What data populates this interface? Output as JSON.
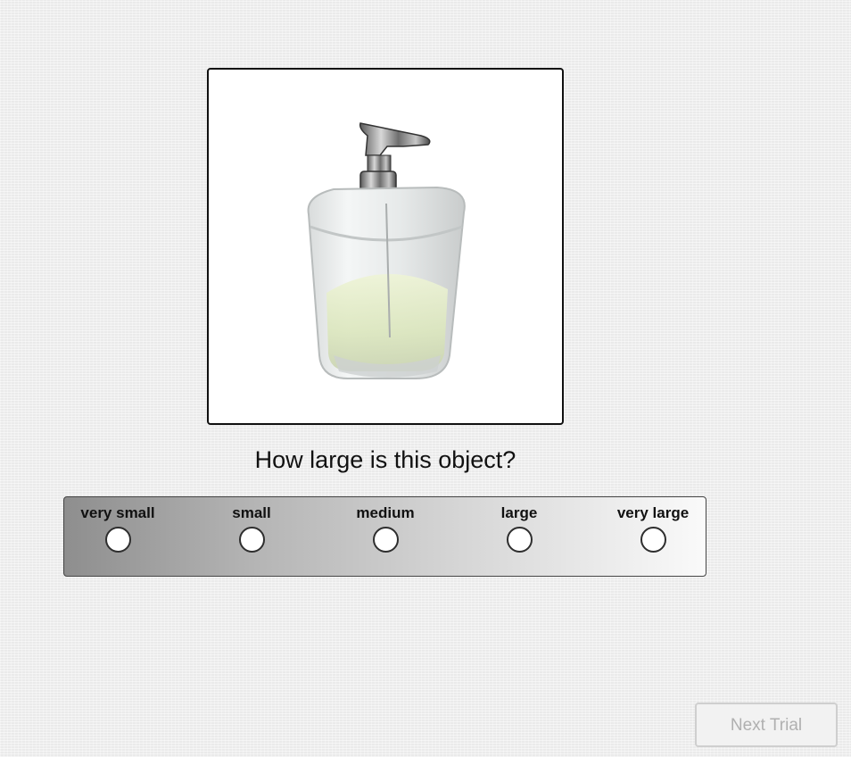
{
  "stimulus": {
    "description_icon": "soap-dispenser-photo"
  },
  "question": "How large is this object?",
  "scale": {
    "options": [
      {
        "label": "very small"
      },
      {
        "label": "small"
      },
      {
        "label": "medium"
      },
      {
        "label": "large"
      },
      {
        "label": "very large"
      }
    ],
    "selected": null
  },
  "next_button": {
    "label": "Next Trial",
    "enabled": false
  },
  "colors": {
    "background": "#f1f1f1",
    "scale_dark": "#8e8e8e",
    "scale_light": "#fafafa",
    "disabled_text": "#b0b0b0"
  }
}
